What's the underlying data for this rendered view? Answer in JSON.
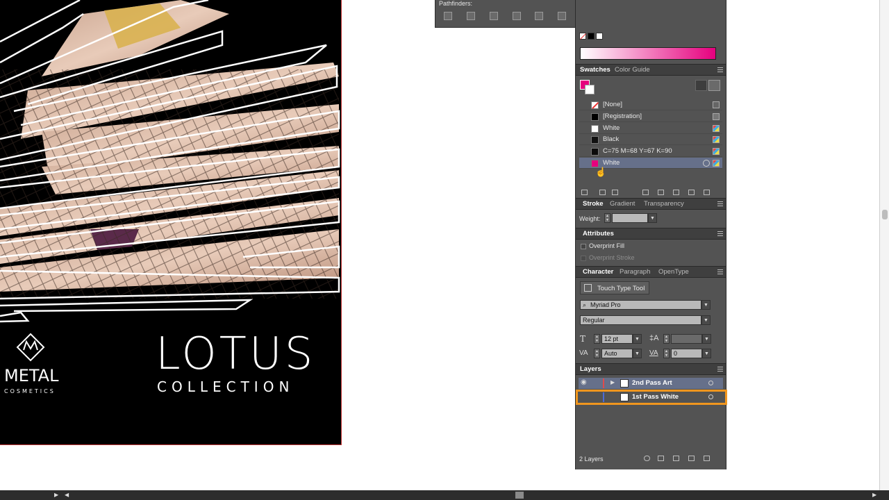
{
  "artboard": {
    "brand_name": "METAL",
    "brand_sub": "COSMETICS",
    "title": "LOTUS",
    "subtitle": "COLLECTION"
  },
  "pathfinder": {
    "title": "Pathfinders:",
    "buttons": [
      "divide-icon",
      "trim-icon",
      "merge-icon",
      "crop-icon",
      "outline-icon",
      "minus-back-icon"
    ]
  },
  "gradient_bar": {
    "from": "#ffffff",
    "to": "#e6007e"
  },
  "swatches_panel": {
    "tabs": [
      "Swatches",
      "Color Guide"
    ],
    "fill_color": "#e6007e",
    "items": [
      {
        "name": "[None]",
        "color": "none"
      },
      {
        "name": "[Registration]",
        "color": "#000000"
      },
      {
        "name": "White",
        "color": "#ffffff"
      },
      {
        "name": "Black",
        "color": "#111111"
      },
      {
        "name": "C=75 M=68 Y=67 K=90",
        "color": "#0b0b0b"
      },
      {
        "name": "White",
        "color": "#e6007e",
        "selected": true
      }
    ]
  },
  "stroke_panel": {
    "tabs": [
      "Stroke",
      "Gradient",
      "Transparency"
    ],
    "weight_label": "Weight:",
    "weight_value": ""
  },
  "attributes_panel": {
    "title": "Attributes",
    "overprint_fill": "Overprint Fill",
    "overprint_stroke": "Overprint Stroke"
  },
  "character_panel": {
    "tabs": [
      "Character",
      "Paragraph",
      "OpenType"
    ],
    "touch_type": "Touch Type Tool",
    "font_family": "Myriad Pro",
    "font_style": "Regular",
    "font_size": "12 pt",
    "leading": "",
    "kerning": "Auto",
    "tracking": "0"
  },
  "layers_panel": {
    "title": "Layers",
    "layers": [
      {
        "name": "2nd Pass Art",
        "color": "#e14b4b"
      },
      {
        "name": "1st Pass White",
        "color": "#4b6bd6"
      }
    ],
    "count": "2 Layers"
  },
  "colors": {
    "accent": "#e6007e",
    "highlight": "#f0961e"
  }
}
